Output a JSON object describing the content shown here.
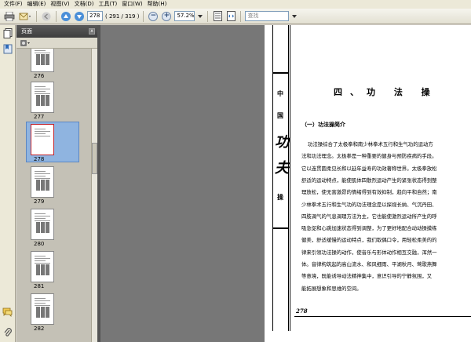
{
  "menu": [
    "文件(F)",
    "编辑(E)",
    "视图(V)",
    "文档(D)",
    "工具(T)",
    "窗口(W)",
    "帮助(H)"
  ],
  "toolbar": {
    "page_input": "278",
    "page_count": "( 291 / 319 )",
    "zoom_value": "57.2%",
    "search_placeholder": "查找",
    "zoom_out": "−",
    "zoom_in": "+"
  },
  "panel": {
    "title": "页面",
    "close": "x",
    "tools_icon": "options-icon"
  },
  "thumbnails": [
    {
      "label": "276",
      "selected": false
    },
    {
      "label": "277",
      "selected": false
    },
    {
      "label": "278",
      "selected": true
    },
    {
      "label": "279",
      "selected": false
    },
    {
      "label": "280",
      "selected": false
    },
    {
      "label": "281",
      "selected": false
    },
    {
      "label": "282",
      "selected": false
    }
  ],
  "document": {
    "side_chars": [
      "中",
      "国",
      "功",
      "夫",
      "操"
    ],
    "chapter_title": "四、功 法 操",
    "section_title": "（一）功法操简介",
    "paragraphs": [
      "功法操综合了太极拳和南少林拳术五行和生气功的运动方",
      "法和功法理念。太极拳是一种重要的健身与预防疾病的手段。",
      "它以连贯圆柔见长和以延年益寿的功效著称世界。太极拳放松",
      "舒适的运动特点，能使肌体四散烈运动产生的紧张状态得到整",
      "理放松，使无害激昂的情绪得到有效抑制，趋向平和自然；南",
      "少林拳术五行和生气功的功法理念是以探视长纳、气沉丹田、",
      "四肢调气的气息调理方法为主，它也能使激烈运动所产生的呼",
      "吸急促和心跳加速状态得到调整，为了更好地配合动动操摸练",
      "健美，舒适缓慢的运动特点，我们取偶口令，用轻松柔美的的",
      "律来引领功法操的动作，使音乐与形体动作相互交融，浑然一",
      "体。音律构筑起的高山流水、和风细雨、平湖秋月、莺歌燕舞",
      "等意境，既能诱导动法精神集中，意识引导的宁静氛围，又",
      "能拓展想象和思维的空间。"
    ],
    "page_number": "278"
  },
  "colors": {
    "selection": "#8fb4e0",
    "panel_header": "#4a4a4a",
    "doc_background": "#777777"
  }
}
